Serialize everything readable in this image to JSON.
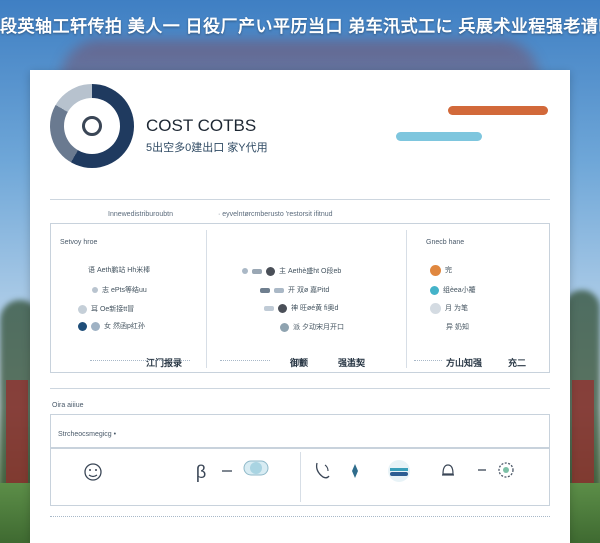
{
  "banner": "段英轴工轩传拍 美人一 日役厂产い平历当口 弟车汛式工に 兵展术业程强老请临",
  "header": {
    "title": "COST COTBS",
    "subtitle": "5出空多0建出口 家Y代用"
  },
  "colors": {
    "accent_orange": "#d2693a",
    "accent_cyan": "#7ec6de",
    "navy": "#1f3a5f"
  },
  "toolbar": {
    "crumb_left": "Innewedistriburoubtn",
    "crumb_right": "· eyvelntørcmberusto 'restorsit ifitnud"
  },
  "sections": {
    "left_label": "Setvoy hroe",
    "right_label": "Gnecb hane",
    "left_rows": [
      "语 Aeth鹏站 Hh米棒",
      "志 ePts等结uu",
      "耳 Oe新接tt冒",
      "女 然函p红孙"
    ],
    "mid_rows": [
      "主 Aethè盛ht O段eb",
      "开 双ø 嘉Pitd",
      "神 旺øé黄 fi奥d",
      "派 夕动宋月开口"
    ],
    "right_rows": [
      "完",
      "组èea小羻",
      "月 为笔",
      "异 奶知"
    ],
    "footer_left": "江门报录",
    "footer_mid_a": "御颤",
    "footer_mid_b": "强滥契",
    "footer_right_a": "方山知强",
    "footer_right_b": "充二"
  },
  "bottom": {
    "section_label": "Oira aiiiue",
    "input_placeholder": "Strcheocsmegicg •"
  },
  "icons": [
    "face-icon",
    "beta-icon",
    "toggle-icon",
    "phone-icon",
    "pen-icon",
    "stack-icon",
    "bell-icon",
    "gear-icon"
  ]
}
